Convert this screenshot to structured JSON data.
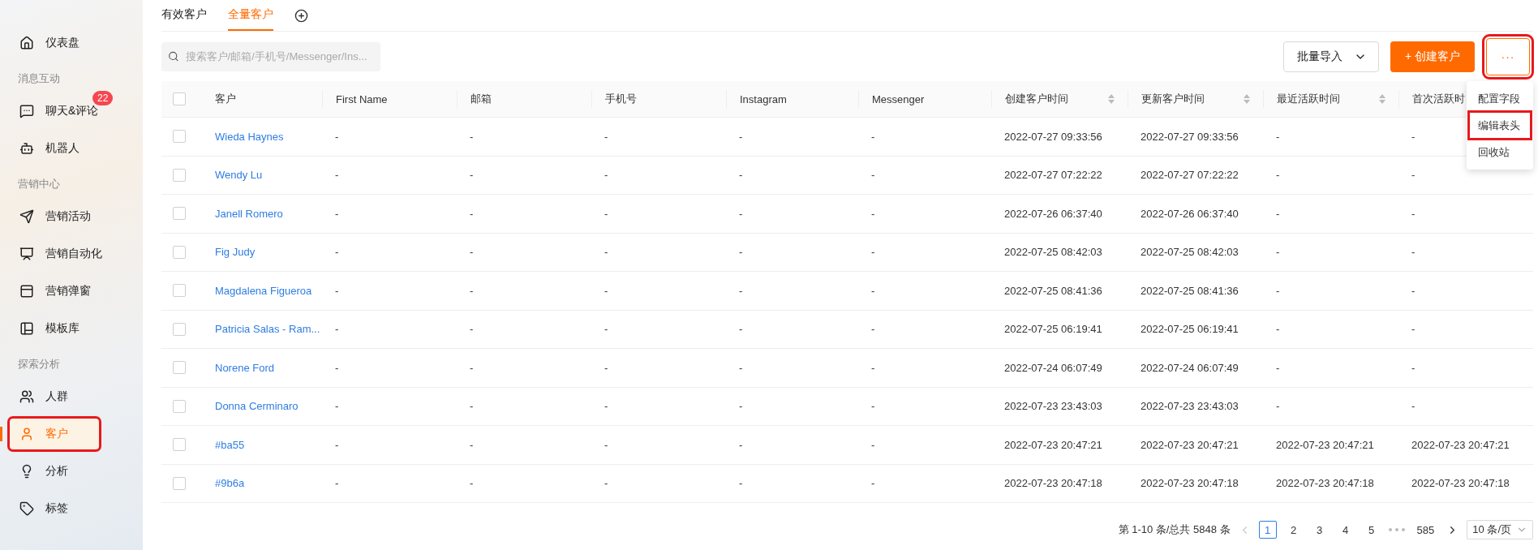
{
  "sidebar": {
    "items": [
      {
        "kind": "item",
        "label": "仪表盘",
        "selected": false,
        "highlighted": false
      },
      {
        "kind": "section",
        "label": "消息互动"
      },
      {
        "kind": "item",
        "label": "聊天&评论",
        "selected": false,
        "highlighted": false,
        "badge": "22"
      },
      {
        "kind": "item",
        "label": "机器人",
        "selected": false,
        "highlighted": false
      },
      {
        "kind": "section",
        "label": "营销中心"
      },
      {
        "kind": "item",
        "label": "营销活动",
        "selected": false,
        "highlighted": false
      },
      {
        "kind": "item",
        "label": "营销自动化",
        "selected": false,
        "highlighted": false
      },
      {
        "kind": "item",
        "label": "营销弹窗",
        "selected": false,
        "highlighted": false
      },
      {
        "kind": "item",
        "label": "模板库",
        "selected": false,
        "highlighted": false
      },
      {
        "kind": "section",
        "label": "探索分析"
      },
      {
        "kind": "item",
        "label": "人群",
        "selected": false,
        "highlighted": false
      },
      {
        "kind": "item",
        "label": "客户",
        "selected": true,
        "highlighted": true
      },
      {
        "kind": "item",
        "label": "分析",
        "selected": false,
        "highlighted": false
      },
      {
        "kind": "item",
        "label": "标签",
        "selected": false,
        "highlighted": false
      }
    ]
  },
  "tabs": [
    {
      "label": "有效客户",
      "selected": false
    },
    {
      "label": "全量客户",
      "selected": true
    }
  ],
  "search": {
    "placeholder": "搜索客户/邮箱/手机号/Messenger/Ins..."
  },
  "toolbar": {
    "import_button": "批量导入",
    "create_button": "+ 创建客户",
    "more_button": {
      "label": "···",
      "highlighted": true
    }
  },
  "menu": {
    "items": [
      {
        "label": "配置字段",
        "highlighted": false
      },
      {
        "label": "编辑表头",
        "highlighted": true
      },
      {
        "label": "回收站",
        "highlighted": false
      }
    ]
  },
  "table": {
    "header_checked": false,
    "columns": [
      {
        "label": "客户",
        "sortable": false
      },
      {
        "label": "First Name",
        "sortable": false
      },
      {
        "label": "邮箱",
        "sortable": false
      },
      {
        "label": "手机号",
        "sortable": false
      },
      {
        "label": "Instagram",
        "sortable": false
      },
      {
        "label": "Messenger",
        "sortable": false
      },
      {
        "label": "创建客户时间",
        "sortable": true
      },
      {
        "label": "更新客户时间",
        "sortable": true
      },
      {
        "label": "最近活跃时间",
        "sortable": true
      },
      {
        "label": "首次活跃时",
        "sortable": false
      }
    ],
    "rows": [
      {
        "checked": false,
        "cells": [
          "Wieda Haynes",
          "-",
          "-",
          "-",
          "-",
          "-",
          "2022-07-27 09:33:56",
          "2022-07-27 09:33:56",
          "-",
          "-"
        ]
      },
      {
        "checked": false,
        "cells": [
          "Wendy Lu",
          "-",
          "-",
          "-",
          "-",
          "-",
          "2022-07-27 07:22:22",
          "2022-07-27 07:22:22",
          "-",
          "-"
        ]
      },
      {
        "checked": false,
        "cells": [
          "Janell Romero",
          "-",
          "-",
          "-",
          "-",
          "-",
          "2022-07-26 06:37:40",
          "2022-07-26 06:37:40",
          "-",
          "-"
        ]
      },
      {
        "checked": false,
        "cells": [
          "Fig Judy",
          "-",
          "-",
          "-",
          "-",
          "-",
          "2022-07-25 08:42:03",
          "2022-07-25 08:42:03",
          "-",
          "-"
        ]
      },
      {
        "checked": false,
        "cells": [
          "Magdalena Figueroa",
          "-",
          "-",
          "-",
          "-",
          "-",
          "2022-07-25 08:41:36",
          "2022-07-25 08:41:36",
          "-",
          "-"
        ]
      },
      {
        "checked": false,
        "cells": [
          "Patricia Salas - Ram...",
          "-",
          "-",
          "-",
          "-",
          "-",
          "2022-07-25 06:19:41",
          "2022-07-25 06:19:41",
          "-",
          "-"
        ]
      },
      {
        "checked": false,
        "cells": [
          "Norene Ford",
          "-",
          "-",
          "-",
          "-",
          "-",
          "2022-07-24 06:07:49",
          "2022-07-24 06:07:49",
          "-",
          "-"
        ]
      },
      {
        "checked": false,
        "cells": [
          "Donna Cerminaro",
          "-",
          "-",
          "-",
          "-",
          "-",
          "2022-07-23 23:43:03",
          "2022-07-23 23:43:03",
          "-",
          "-"
        ]
      },
      {
        "checked": false,
        "cells": [
          "#ba55",
          "-",
          "-",
          "-",
          "-",
          "-",
          "2022-07-23 20:47:21",
          "2022-07-23 20:47:21",
          "2022-07-23 20:47:21",
          "2022-07-23 20:47:21"
        ]
      },
      {
        "checked": false,
        "cells": [
          "#9b6a",
          "-",
          "-",
          "-",
          "-",
          "-",
          "2022-07-23 20:47:18",
          "2022-07-23 20:47:18",
          "2022-07-23 20:47:18",
          "2022-07-23 20:47:18"
        ]
      }
    ]
  },
  "pagination": {
    "summary": "第 1-10 条/总共 5848 条",
    "prev_disabled": true,
    "pages": [
      {
        "label": "1",
        "selected": true
      },
      {
        "label": "2",
        "selected": false
      },
      {
        "label": "3",
        "selected": false
      },
      {
        "label": "4",
        "selected": false
      },
      {
        "label": "5",
        "selected": false
      },
      {
        "kind": "ellipsis"
      },
      {
        "label": "585",
        "selected": false
      }
    ],
    "page_size": "10 条/页"
  }
}
